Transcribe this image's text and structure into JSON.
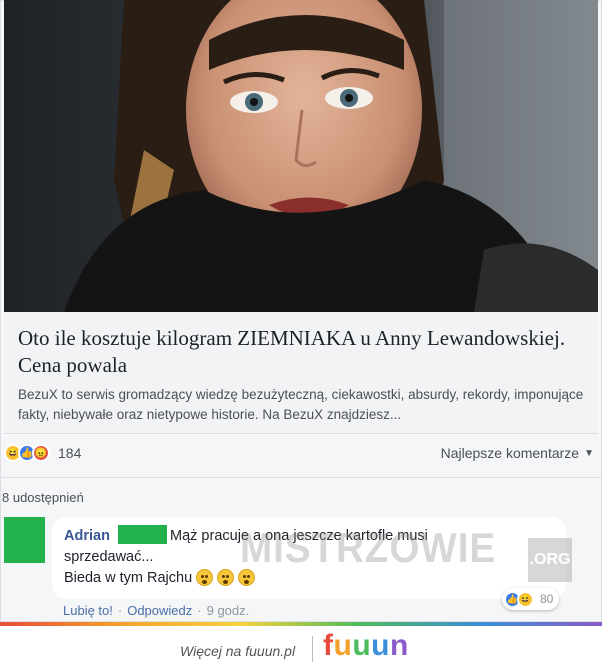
{
  "link_preview": {
    "title": "Oto ile kosztuje kilogram ZIEMNIAKA u Anny Lewandowskiej. Cena powala",
    "description": "BezuX to serwis gromadzący wiedzę bezużyteczną, ciekawostki, absurdy, rekordy, imponujące fakty, niebywałe oraz nietypowe historie. Na BezuX znajdziesz..."
  },
  "post_reactions": {
    "icons": [
      "haha-reaction-icon",
      "like-reaction-icon",
      "angry-reaction-icon"
    ],
    "count": "184"
  },
  "sort": {
    "label": "Najlepsze komentarze",
    "icon": "caret-down-icon"
  },
  "shares": {
    "label": "8 udostępnień"
  },
  "comment": {
    "author": "Adrian",
    "line1": "Mąż pracuje a ona jeszcze kartofle musi",
    "line2": "sprzedawać...",
    "line3": "Bieda w tym Rajchu",
    "emojis": [
      "smile-emoji",
      "smile-emoji",
      "smile-emoji"
    ],
    "reactions": {
      "icons": [
        "like-reaction-icon",
        "haha-reaction-icon"
      ],
      "count": "80"
    },
    "actions": {
      "like": "Lubię to!",
      "reply": "Odpowiedz",
      "time": "9 godz."
    }
  },
  "watermark": {
    "text": "MISTRZOWIE",
    "suffix": ".ORG"
  },
  "footer": {
    "more_text": "Więcej na fuuun.pl",
    "logo_letters": [
      "f",
      "u",
      "u",
      "u",
      "n"
    ]
  },
  "colors": {
    "link_blue": "#385898",
    "redaction_green": "#22b14c",
    "like_blue": "#3b7cf0",
    "haha_yellow": "#f7c63a",
    "angry_red": "#e2504a"
  }
}
